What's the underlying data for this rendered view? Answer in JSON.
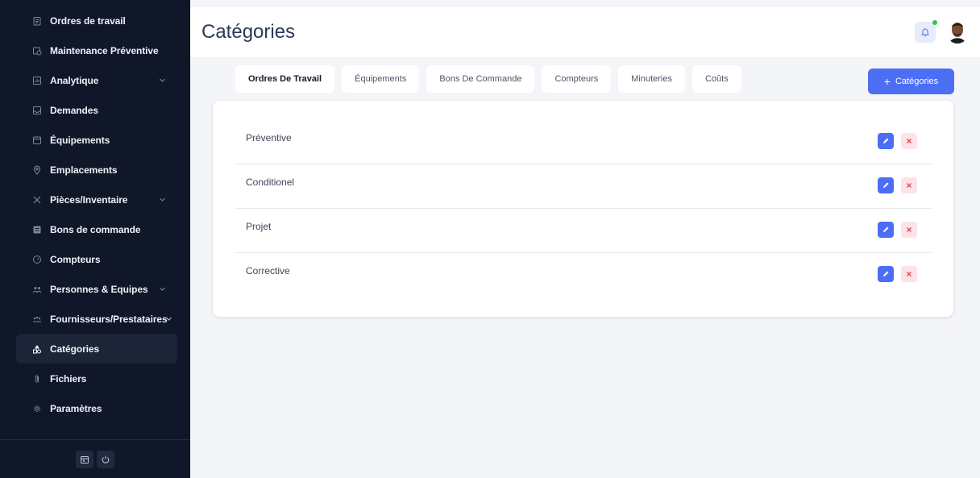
{
  "sidebar": {
    "items": [
      {
        "label": "Ordres de travail",
        "icon": "clipboard-icon"
      },
      {
        "label": "Maintenance Préventive",
        "icon": "calendar-clock-icon"
      },
      {
        "label": "Analytique",
        "icon": "chart-icon",
        "expandable": true
      },
      {
        "label": "Demandes",
        "icon": "inbox-icon"
      },
      {
        "label": "Équipements",
        "icon": "box-icon"
      },
      {
        "label": "Emplacements",
        "icon": "location-pin-icon"
      },
      {
        "label": "Pièces/Inventaire",
        "icon": "tools-icon",
        "expandable": true
      },
      {
        "label": "Bons de commande",
        "icon": "document-icon"
      },
      {
        "label": "Compteurs",
        "icon": "gauge-icon"
      },
      {
        "label": "Personnes & Equipes",
        "icon": "people-icon",
        "expandable": true
      },
      {
        "label": "Fournisseurs/Prestataires",
        "icon": "vendors-icon",
        "expandable": true
      },
      {
        "label": "Catégories",
        "icon": "categories-icon",
        "active": true
      },
      {
        "label": "Fichiers",
        "icon": "paperclip-icon"
      },
      {
        "label": "Paramètres",
        "icon": "gear-icon"
      }
    ]
  },
  "header": {
    "title": "Catégories"
  },
  "tabs": [
    {
      "label": "Ordres De Travail",
      "active": true
    },
    {
      "label": "Équipements"
    },
    {
      "label": "Bons De Commande"
    },
    {
      "label": "Compteurs"
    },
    {
      "label": "Minuteries"
    },
    {
      "label": "Coûts"
    }
  ],
  "actions": {
    "add_label": "Catégories",
    "add_symbol": "+"
  },
  "categories": [
    {
      "label": "Préventive"
    },
    {
      "label": "Conditionel"
    },
    {
      "label": "Projet"
    },
    {
      "label": "Corrective"
    }
  ],
  "colors": {
    "sidebar_bg": "#0f1729",
    "accent": "#4c6ef5",
    "delete_bg": "#fde2e6",
    "delete_fg": "#e5484d",
    "notification_dot": "#3fbf4a"
  }
}
